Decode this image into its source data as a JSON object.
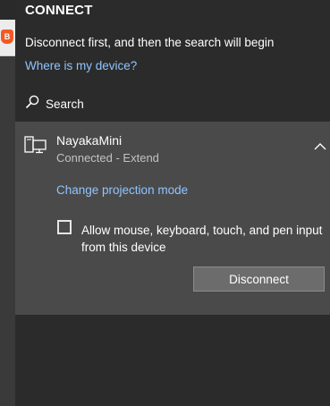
{
  "panel": {
    "title": "CONNECT",
    "info_text": "Disconnect first, and then the search will begin",
    "where_link": "Where is my device?",
    "search_label": "Search"
  },
  "device": {
    "name": "NayakaMini",
    "status": "Connected - Extend",
    "mode_link": "Change projection mode",
    "input_checkbox_label": "Allow mouse, keyboard, touch, and pen input from this device",
    "input_checkbox_checked": false,
    "disconnect_label": "Disconnect"
  },
  "colors": {
    "link": "#8fc5ff",
    "panel_bg": "#2b2b2b",
    "card_bg": "#4a4a4a",
    "button_bg": "#6c6c6c"
  }
}
